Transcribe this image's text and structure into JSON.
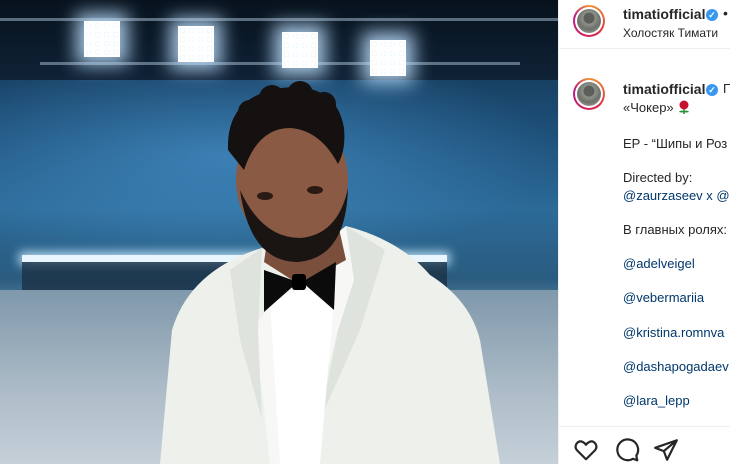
{
  "post_header": {
    "username": "timatiofficial",
    "separator": "•",
    "location": "Холостяк Тимати"
  },
  "caption": {
    "username": "timatiofficial",
    "line1_start": "П",
    "line2": "«Чокер»",
    "ep_line": "EP - “Шипы и Роз",
    "directed_label": "Directed by:",
    "directors": "@zaurzaseev x @",
    "cast_label": "В главных ролях:",
    "mentions": [
      "@adelveigel",
      "@vebermariia",
      "@kristina.romnva",
      "@dashapogadaev",
      "@lara_lepp"
    ]
  },
  "actions": {
    "like_icon": "heart-icon",
    "comment_icon": "comment-icon",
    "share_icon": "paper-plane-icon"
  },
  "colors": {
    "text": "#262626",
    "link": "#00376b",
    "verified": "#3897f0",
    "stage_blue": "#2c6a98"
  }
}
